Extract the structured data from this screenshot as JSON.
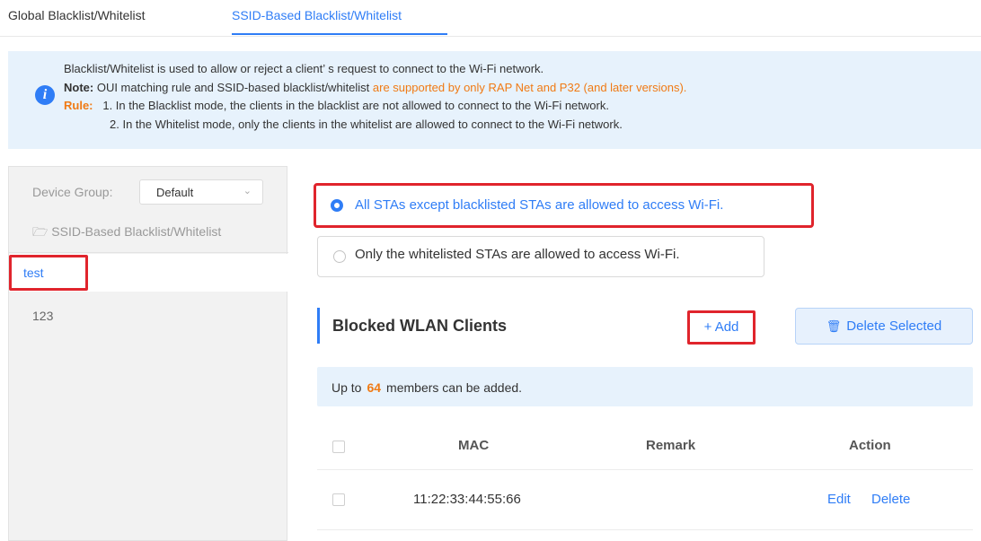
{
  "tabs": [
    {
      "label": "Global Blacklist/Whitelist"
    },
    {
      "label": "SSID-Based Blacklist/Whitelist"
    }
  ],
  "notice": {
    "line1": "Blacklist/Whitelist is used to allow or reject a client’ s request to connect to the Wi-Fi network.",
    "note_label": "Note:",
    "note_text": " OUI matching rule and SSID-based blacklist/whitelist ",
    "note_highlight": "are supported by only RAP Net and P32 (and later versions).",
    "rule_label": "Rule:",
    "rule1": "1. In the Blacklist mode, the clients in the blacklist are not allowed to connect to the Wi-Fi network.",
    "rule2": "2. In the Whitelist mode, only the clients in the whitelist are allowed to connect to the Wi-Fi network."
  },
  "sidebar": {
    "device_group_label": "Device Group:",
    "device_group_value": "Default",
    "folder_label": "SSID-Based Blacklist/Whitelist",
    "items": [
      {
        "label": "test"
      },
      {
        "label": "123"
      }
    ]
  },
  "mode": {
    "option_blacklist": "All STAs except blacklisted STAs are allowed to access Wi-Fi.",
    "option_whitelist": "Only the whitelisted STAs are allowed to access Wi-Fi.",
    "selected": "blacklist"
  },
  "section": {
    "title": "Blocked WLAN Clients",
    "add_label": "+ Add",
    "delete_label": "Delete Selected"
  },
  "limit": {
    "prefix": "Up to",
    "count": "64",
    "suffix": "members can be added."
  },
  "table": {
    "columns": [
      "MAC",
      "Remark",
      "Action"
    ],
    "rows": [
      {
        "mac": "11:22:33:44:55:66",
        "remark": "",
        "edit": "Edit",
        "delete": "Delete"
      }
    ]
  },
  "colors": {
    "accent": "#2f7df6",
    "highlight_box": "#e0242c",
    "warning": "#f07a14"
  }
}
